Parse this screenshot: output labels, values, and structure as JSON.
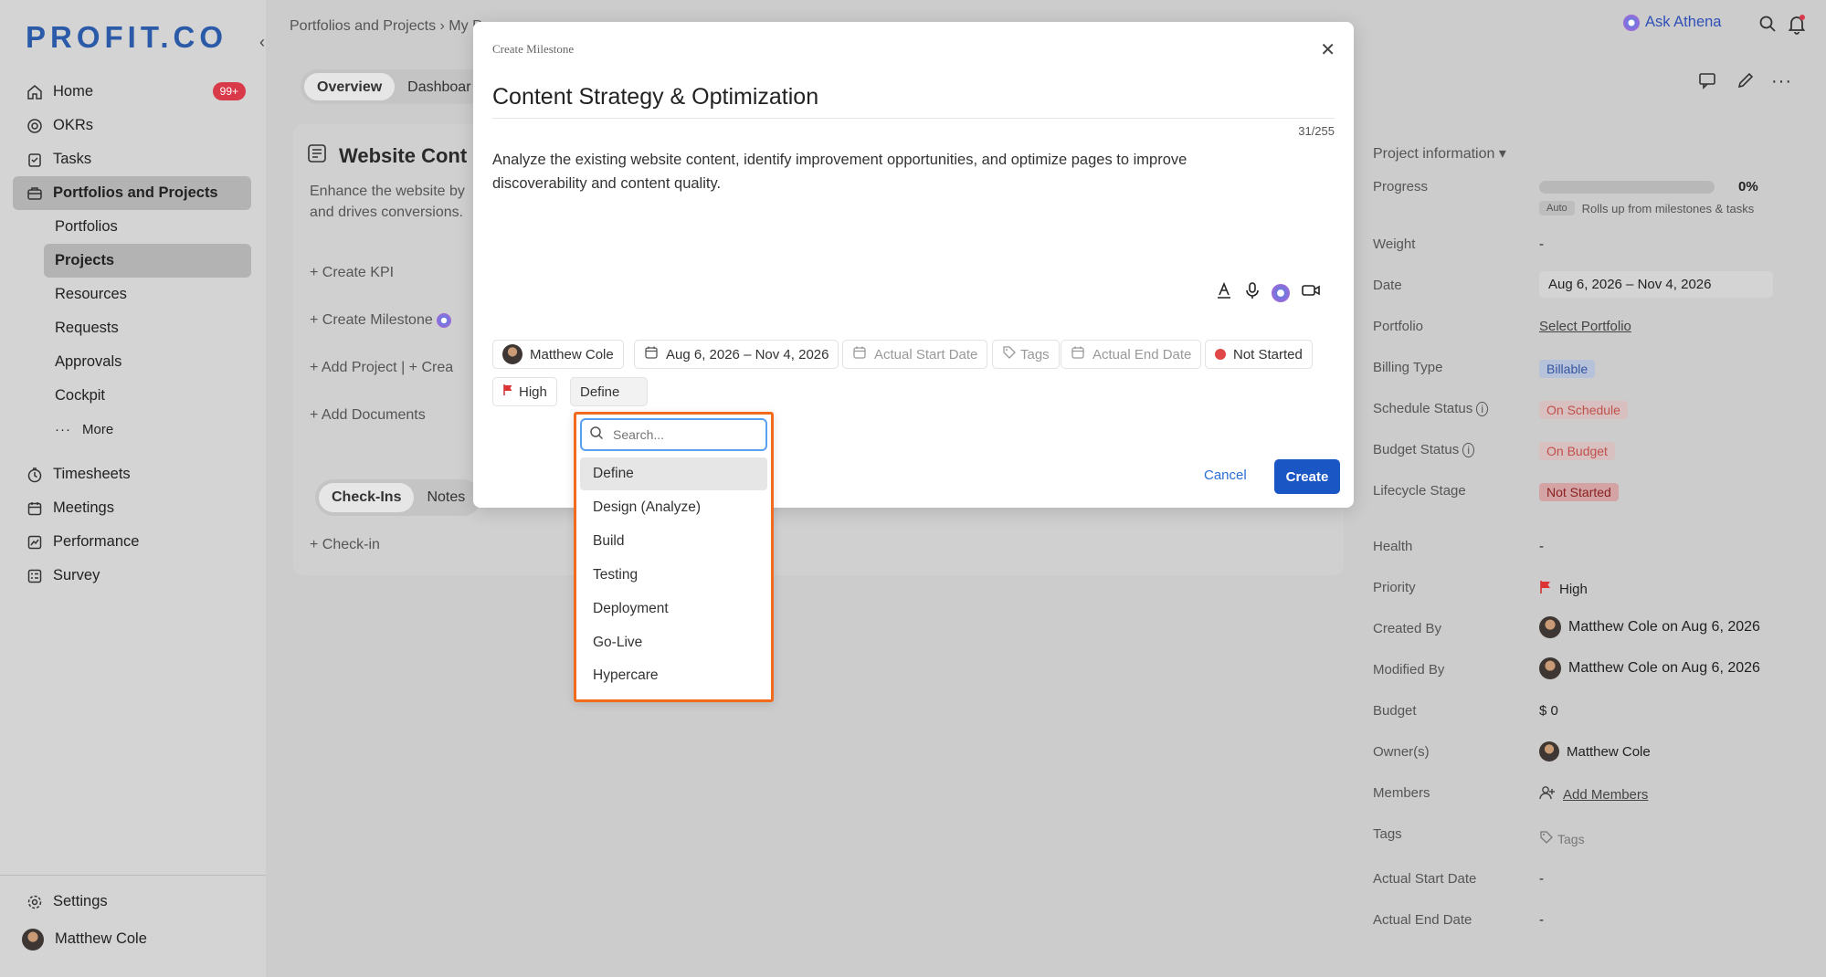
{
  "sidebar": {
    "logo": "PROFIT.CO",
    "collapse": "‹",
    "items": [
      {
        "label": "Home",
        "badge": "99+"
      },
      {
        "label": "OKRs"
      },
      {
        "label": "Tasks"
      },
      {
        "label": "Portfolios and Projects"
      }
    ],
    "sub_items": [
      "Portfolios",
      "Projects",
      "Resources",
      "Requests",
      "Approvals",
      "Cockpit",
      "More"
    ],
    "lower_items": [
      "Timesheets",
      "Meetings",
      "Performance",
      "Survey"
    ],
    "settings": "Settings",
    "user": "Matthew Cole"
  },
  "topbar": {
    "breadcrumb": "Portfolios and Projects  ›  My P",
    "ask": "Ask Athena"
  },
  "tabs": [
    "Overview",
    "Dashboar"
  ],
  "project": {
    "title": "Website Cont",
    "desc": "Enhance the website by and drives conversions.",
    "actions": [
      "Create KPI",
      "Create Milestone",
      "Add Project  |  + Crea",
      "Add Documents"
    ],
    "checkin_tabs": [
      "Check-Ins",
      "Notes"
    ],
    "checkin": "Check-in"
  },
  "info": {
    "header": "Project information",
    "progress_label": "Progress",
    "progress_value": "0%",
    "progress_fraction": 0,
    "auto": "Auto",
    "auto_note": "Rolls up from milestones & tasks",
    "rows": {
      "weight": {
        "label": "Weight",
        "value": "-"
      },
      "date": {
        "label": "Date",
        "value": "Aug 6, 2026 – Nov 4, 2026"
      },
      "portfolio": {
        "label": "Portfolio",
        "value": "Select Portfolio"
      },
      "billing": {
        "label": "Billing Type",
        "value": "Billable"
      },
      "schedule": {
        "label": "Schedule Status",
        "value": "On Schedule"
      },
      "budget_status": {
        "label": "Budget Status",
        "value": "On Budget"
      },
      "lifecycle": {
        "label": "Lifecycle Stage",
        "value": "Not Started"
      },
      "health": {
        "label": "Health",
        "value": "-"
      },
      "priority": {
        "label": "Priority",
        "value": "High"
      },
      "created": {
        "label": "Created By",
        "value": "Matthew Cole  on Aug 6, 2026"
      },
      "modified": {
        "label": "Modified By",
        "value": "Matthew Cole  on Aug 6, 2026"
      },
      "budget": {
        "label": "Budget",
        "value": "$ 0"
      },
      "owners": {
        "label": "Owner(s)",
        "value": "Matthew Cole"
      },
      "members": {
        "label": "Members",
        "value": "Add Members"
      },
      "tags": {
        "label": "Tags",
        "value": "Tags"
      },
      "actual_start": {
        "label": "Actual Start Date",
        "value": "-"
      },
      "actual_end": {
        "label": "Actual End Date",
        "value": "-"
      }
    }
  },
  "modal": {
    "label": "Create Milestone",
    "title": "Content Strategy & Optimization",
    "counter": "31/255",
    "description": "Analyze the existing website content, identify improvement opportunities, and optimize pages to improve discoverability and content quality.",
    "chips": {
      "owner": "Matthew Cole",
      "date": "Aug 6, 2026 – Nov 4, 2026",
      "actual_start": "Actual Start Date",
      "tags": "Tags",
      "actual_end": "Actual End Date",
      "status": "Not Started",
      "priority": "High",
      "stage": "Define"
    },
    "cancel": "Cancel",
    "create": "Create"
  },
  "dropdown": {
    "placeholder": "Search...",
    "options": [
      "Define",
      "Design (Analyze)",
      "Build",
      "Testing",
      "Deployment",
      "Go-Live",
      "Hypercare"
    ],
    "selected": "Define"
  },
  "colors": {
    "accent": "#1a57c5",
    "highlight_border": "#f26a1b",
    "badge": "#d93a4a"
  }
}
